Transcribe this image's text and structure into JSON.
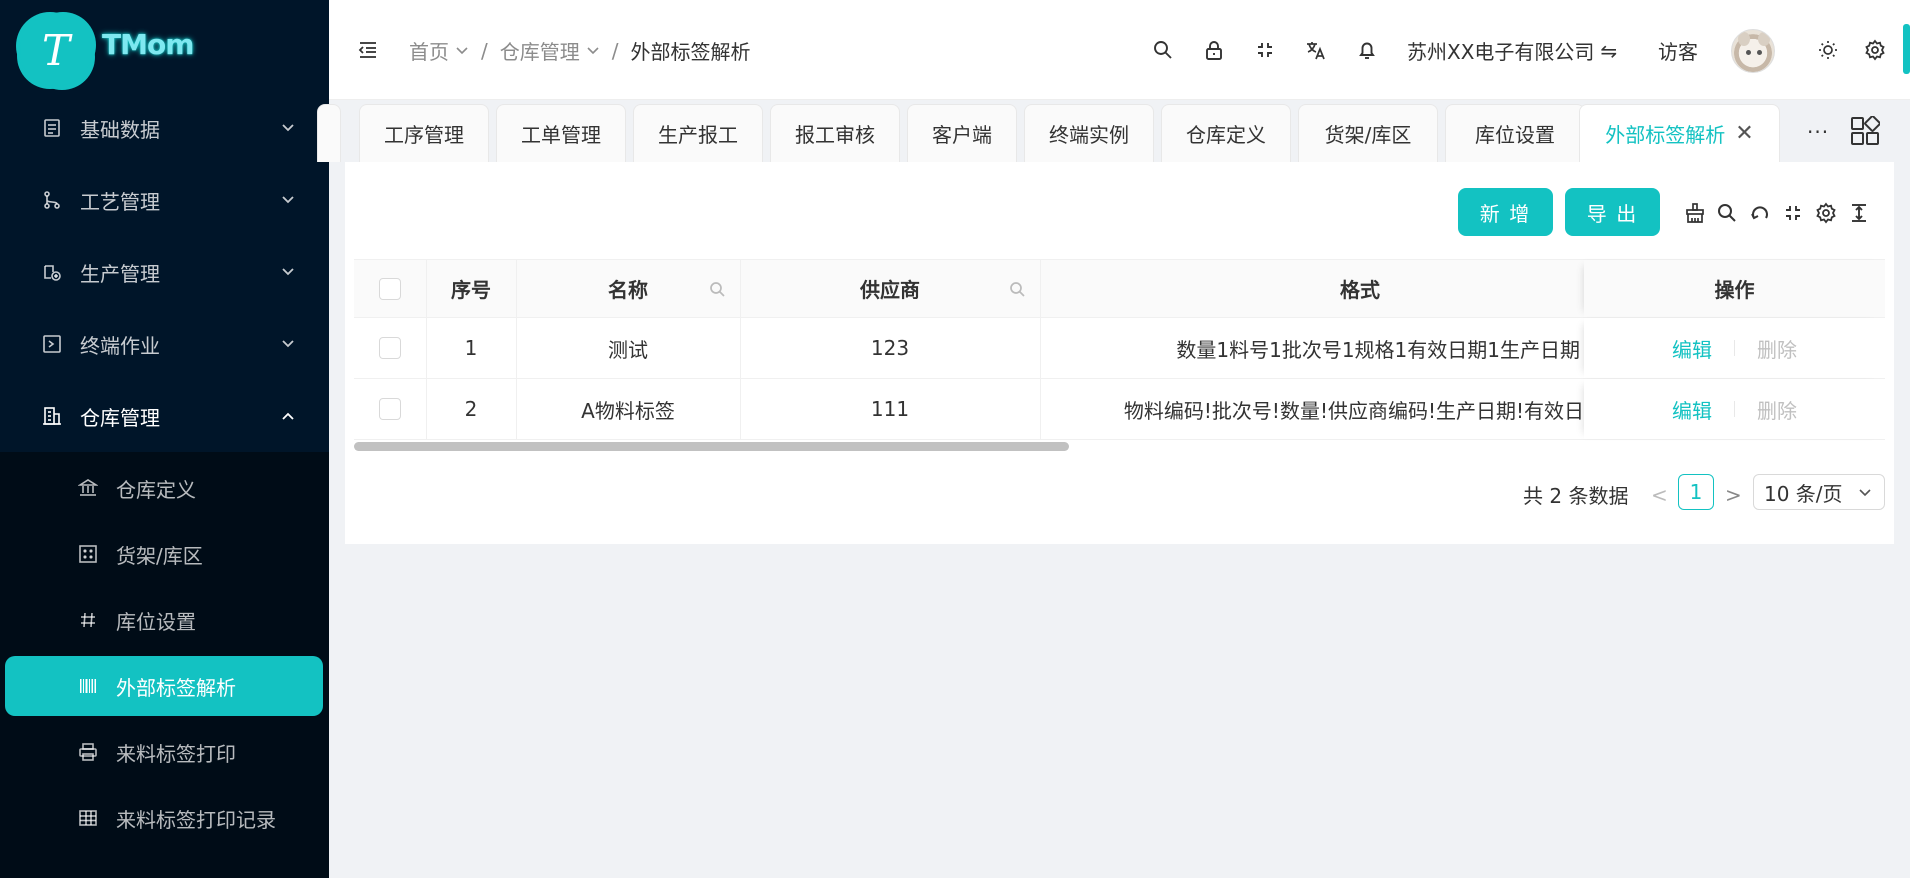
{
  "app": {
    "logo_letter": "T",
    "logo_text": "TMom"
  },
  "sidebar": {
    "items": [
      {
        "label": "基础数据",
        "icon": "document-icon"
      },
      {
        "label": "工艺管理",
        "icon": "branch-icon"
      },
      {
        "label": "生产管理",
        "icon": "production-icon"
      },
      {
        "label": "终端作业",
        "icon": "terminal-icon"
      },
      {
        "label": "仓库管理",
        "icon": "building-icon"
      }
    ],
    "sub_items": [
      {
        "label": "仓库定义",
        "icon": "bank-icon"
      },
      {
        "label": "货架/库区",
        "icon": "shelf-icon"
      },
      {
        "label": "库位设置",
        "icon": "hash-icon"
      },
      {
        "label": "外部标签解析",
        "icon": "barcode-icon"
      },
      {
        "label": "来料标签打印",
        "icon": "printer-icon"
      },
      {
        "label": "来料标签打印记录",
        "icon": "table-icon"
      }
    ]
  },
  "header": {
    "breadcrumb": [
      "首页",
      "仓库管理",
      "外部标签解析"
    ],
    "company": "苏州XX电子有限公司",
    "swap_glyph": "⇋",
    "user": "访客"
  },
  "tabs": [
    "工序管理",
    "工单管理",
    "生产报工",
    "报工审核",
    "客户端",
    "终端实例",
    "仓库定义",
    "货架/库区",
    "库位设置",
    "外部标签解析"
  ],
  "tabs_more": "···",
  "toolbar": {
    "add_label": "新 增",
    "export_label": "导 出"
  },
  "table": {
    "headers": [
      "序号",
      "名称",
      "供应商",
      "格式",
      "操作"
    ],
    "rows": [
      {
        "index": "1",
        "name": "测试",
        "supplier": "123",
        "format": "数量1料号1批次号1规格1有效日期1生产日期"
      },
      {
        "index": "2",
        "name": "A物料标签",
        "supplier": "111",
        "format": "物料编码!批次号!数量!供应商编码!生产日期!有效日"
      }
    ],
    "edit_label": "编辑",
    "delete_label": "删除"
  },
  "pagination": {
    "total_text": "共 2 条数据",
    "prev": "<",
    "next": ">",
    "current": "1",
    "page_size": "10 条/页"
  },
  "colors": {
    "accent": "#13c2c2",
    "sidebar_bg": "#001529",
    "submenu_bg": "#000c17"
  }
}
